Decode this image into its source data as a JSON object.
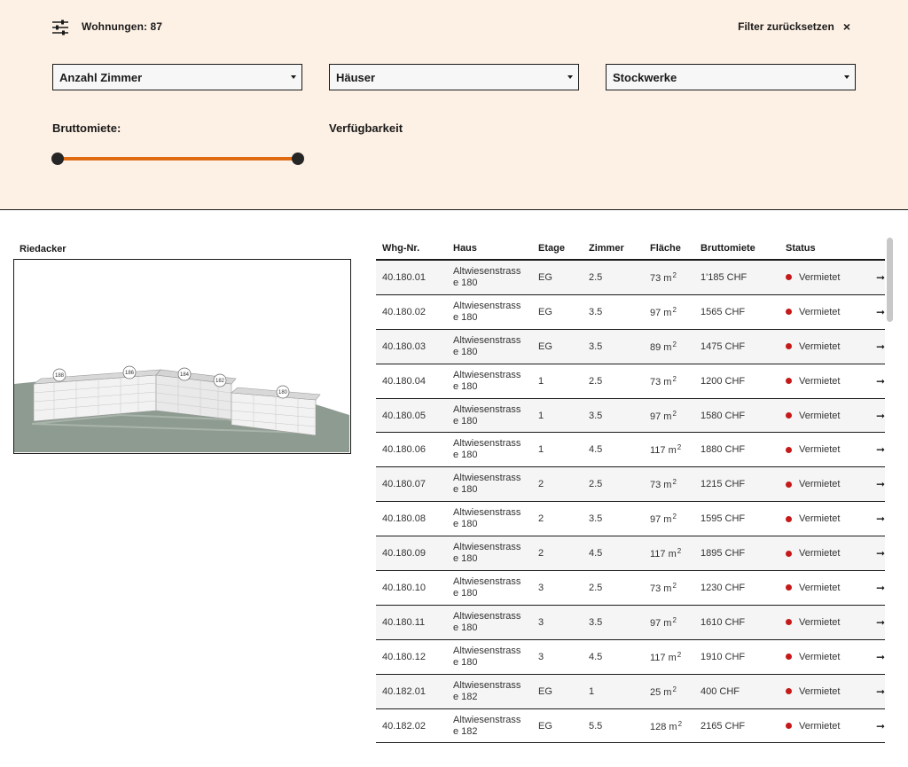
{
  "filter": {
    "count_label": "Wohnungen: 87",
    "reset_label": "Filter zurücksetzen",
    "reset_icon": "×",
    "selects": {
      "zimmer": "Anzahl Zimmer",
      "haeuser": "Häuser",
      "stockwerke": "Stockwerke"
    },
    "bruttomiete_label": "Bruttomiete:",
    "verfuegbarkeit_label": "Verfügbarkeit",
    "range": {
      "min_fraction": 0.0,
      "max_fraction": 1.0
    },
    "colors": {
      "panel_bg": "#fdf0e4",
      "slider_accent": "#e06b13"
    }
  },
  "map": {
    "title": "Riedacker",
    "house_markers": [
      "188",
      "186",
      "184",
      "182",
      "180"
    ]
  },
  "table": {
    "headers": {
      "nr": "Whg-Nr.",
      "haus": "Haus",
      "etage": "Etage",
      "zimmer": "Zimmer",
      "flaeche": "Fläche",
      "miete": "Bruttomiete",
      "status": "Status"
    },
    "rows": [
      {
        "nr": "40.180.01",
        "haus1": "Altwiesenstrass",
        "haus2": "e 180",
        "etage": "EG",
        "zimmer": "2.5",
        "flaeche": "73 m",
        "miete": "1'185 CHF",
        "status": "Vermietet"
      },
      {
        "nr": "40.180.02",
        "haus1": "Altwiesenstrass",
        "haus2": "e 180",
        "etage": "EG",
        "zimmer": "3.5",
        "flaeche": "97 m",
        "miete": "1565 CHF",
        "status": "Vermietet"
      },
      {
        "nr": "40.180.03",
        "haus1": "Altwiesenstrass",
        "haus2": "e 180",
        "etage": "EG",
        "zimmer": "3.5",
        "flaeche": "89 m",
        "miete": "1475 CHF",
        "status": "Vermietet"
      },
      {
        "nr": "40.180.04",
        "haus1": "Altwiesenstrass",
        "haus2": "e 180",
        "etage": "1",
        "zimmer": "2.5",
        "flaeche": "73 m",
        "miete": "1200 CHF",
        "status": "Vermietet"
      },
      {
        "nr": "40.180.05",
        "haus1": "Altwiesenstrass",
        "haus2": "e 180",
        "etage": "1",
        "zimmer": "3.5",
        "flaeche": "97 m",
        "miete": "1580 CHF",
        "status": "Vermietet"
      },
      {
        "nr": "40.180.06",
        "haus1": "Altwiesenstrass",
        "haus2": "e 180",
        "etage": "1",
        "zimmer": "4.5",
        "flaeche": "117 m",
        "miete": "1880 CHF",
        "status": "Vermietet"
      },
      {
        "nr": "40.180.07",
        "haus1": "Altwiesenstrass",
        "haus2": "e 180",
        "etage": "2",
        "zimmer": "2.5",
        "flaeche": "73 m",
        "miete": "1215 CHF",
        "status": "Vermietet"
      },
      {
        "nr": "40.180.08",
        "haus1": "Altwiesenstrass",
        "haus2": "e 180",
        "etage": "2",
        "zimmer": "3.5",
        "flaeche": "97 m",
        "miete": "1595 CHF",
        "status": "Vermietet"
      },
      {
        "nr": "40.180.09",
        "haus1": "Altwiesenstrass",
        "haus2": "e 180",
        "etage": "2",
        "zimmer": "4.5",
        "flaeche": "117 m",
        "miete": "1895 CHF",
        "status": "Vermietet"
      },
      {
        "nr": "40.180.10",
        "haus1": "Altwiesenstrass",
        "haus2": "e 180",
        "etage": "3",
        "zimmer": "2.5",
        "flaeche": "73 m",
        "miete": "1230 CHF",
        "status": "Vermietet"
      },
      {
        "nr": "40.180.11",
        "haus1": "Altwiesenstrass",
        "haus2": "e 180",
        "etage": "3",
        "zimmer": "3.5",
        "flaeche": "97 m",
        "miete": "1610 CHF",
        "status": "Vermietet"
      },
      {
        "nr": "40.180.12",
        "haus1": "Altwiesenstrass",
        "haus2": "e 180",
        "etage": "3",
        "zimmer": "4.5",
        "flaeche": "117 m",
        "miete": "1910 CHF",
        "status": "Vermietet"
      },
      {
        "nr": "40.182.01",
        "haus1": "Altwiesenstrass",
        "haus2": "e 182",
        "etage": "EG",
        "zimmer": "1",
        "flaeche": "25 m",
        "miete": "400 CHF",
        "status": "Vermietet"
      },
      {
        "nr": "40.182.02",
        "haus1": "Altwiesenstrass",
        "haus2": "e 182",
        "etage": "EG",
        "zimmer": "5.5",
        "flaeche": "128 m",
        "miete": "2165 CHF",
        "status": "Vermietet"
      }
    ],
    "area_superscript": "2",
    "row_arrow_icon": "arrow-right-icon",
    "status_color": "#c61a1a"
  }
}
